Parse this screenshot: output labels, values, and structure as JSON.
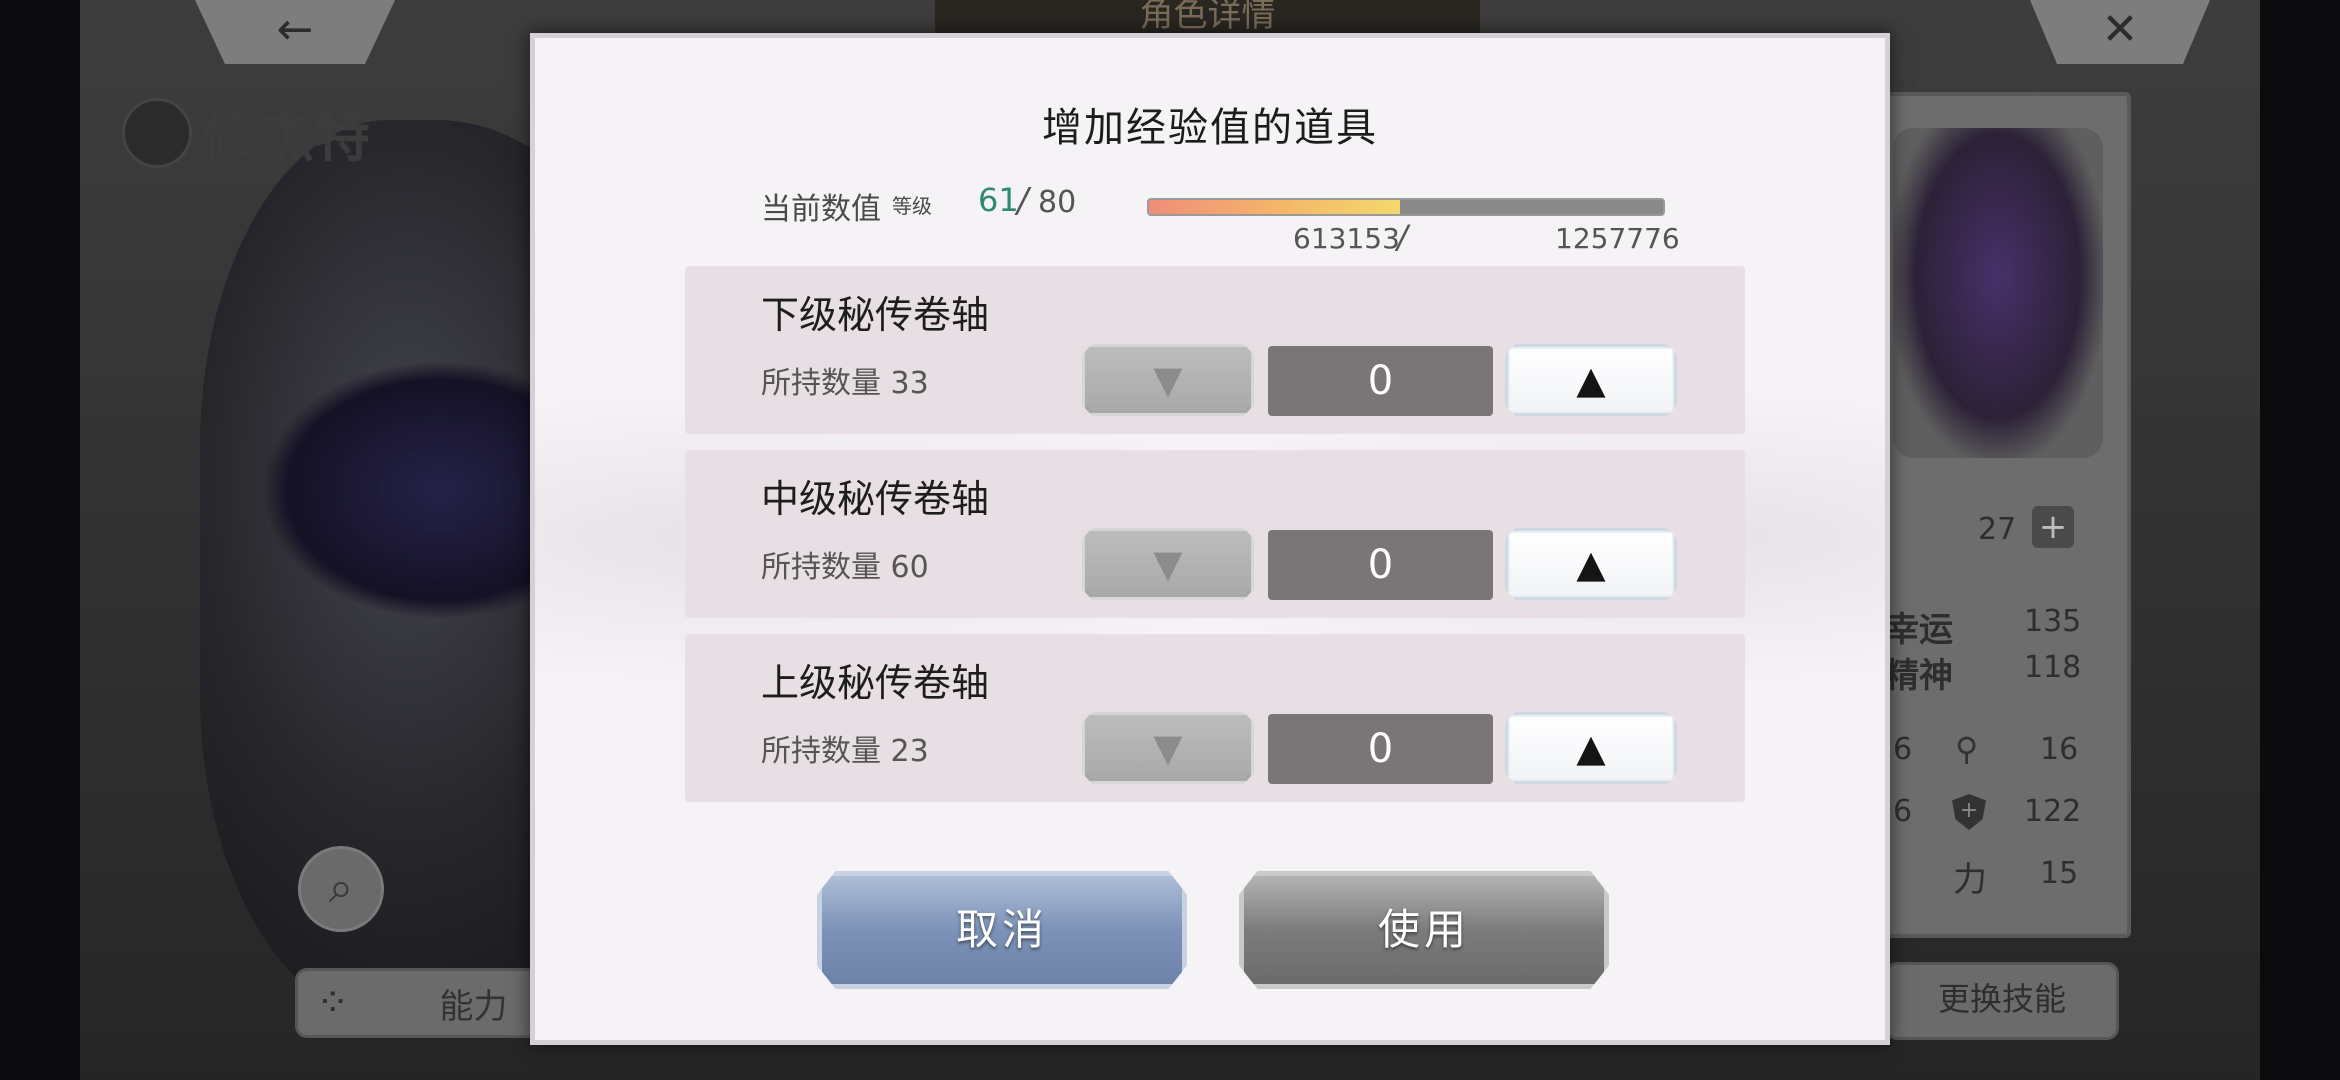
{
  "background": {
    "top_tab_title": "角色详情",
    "back_icon": "arrow-left-icon",
    "close_icon": "close-icon",
    "back_glyph": "←",
    "close_glyph": "✕",
    "character_name": "修杰特",
    "search_glyph": "⌕",
    "ability_tab_label": "能力",
    "ability_tab_glyph": "⁘",
    "change_skill_label": "更换技能",
    "plus_glyph": "+",
    "stats": [
      {
        "label": "",
        "value": "27"
      },
      {
        "label": "幸运",
        "value": "135"
      },
      {
        "label": "精神",
        "value": "118"
      },
      {
        "label": "6",
        "value": "16"
      },
      {
        "label": "6",
        "value": "122"
      },
      {
        "label": "力",
        "value": "15"
      }
    ]
  },
  "modal": {
    "title": "增加经验值的道具",
    "current_label": "当前数值",
    "level_sub_label": "等级",
    "level_current": "61",
    "level_slash": "/",
    "level_max": "80",
    "exp_current": "613153",
    "exp_slash": "/",
    "exp_max": "1257776",
    "exp_fraction": 0.4875,
    "items": [
      {
        "name": "下级秘传卷轴",
        "qty_label": "所持数量 33",
        "count": "0",
        "down_glyph": "▼",
        "up_glyph": "▲"
      },
      {
        "name": "中级秘传卷轴",
        "qty_label": "所持数量 60",
        "count": "0",
        "down_glyph": "▼",
        "up_glyph": "▲"
      },
      {
        "name": "上级秘传卷轴",
        "qty_label": "所持数量 23",
        "count": "0",
        "down_glyph": "▼",
        "up_glyph": "▲"
      }
    ],
    "cancel_label": "取消",
    "use_label": "使用"
  },
  "colors": {
    "level_accent": "#2e8a72",
    "exp_fill_start": "#ef8e7a",
    "exp_fill_end": "#f4d96a",
    "cancel_button": "#7d92b8",
    "use_button": "#7c7c7c"
  }
}
